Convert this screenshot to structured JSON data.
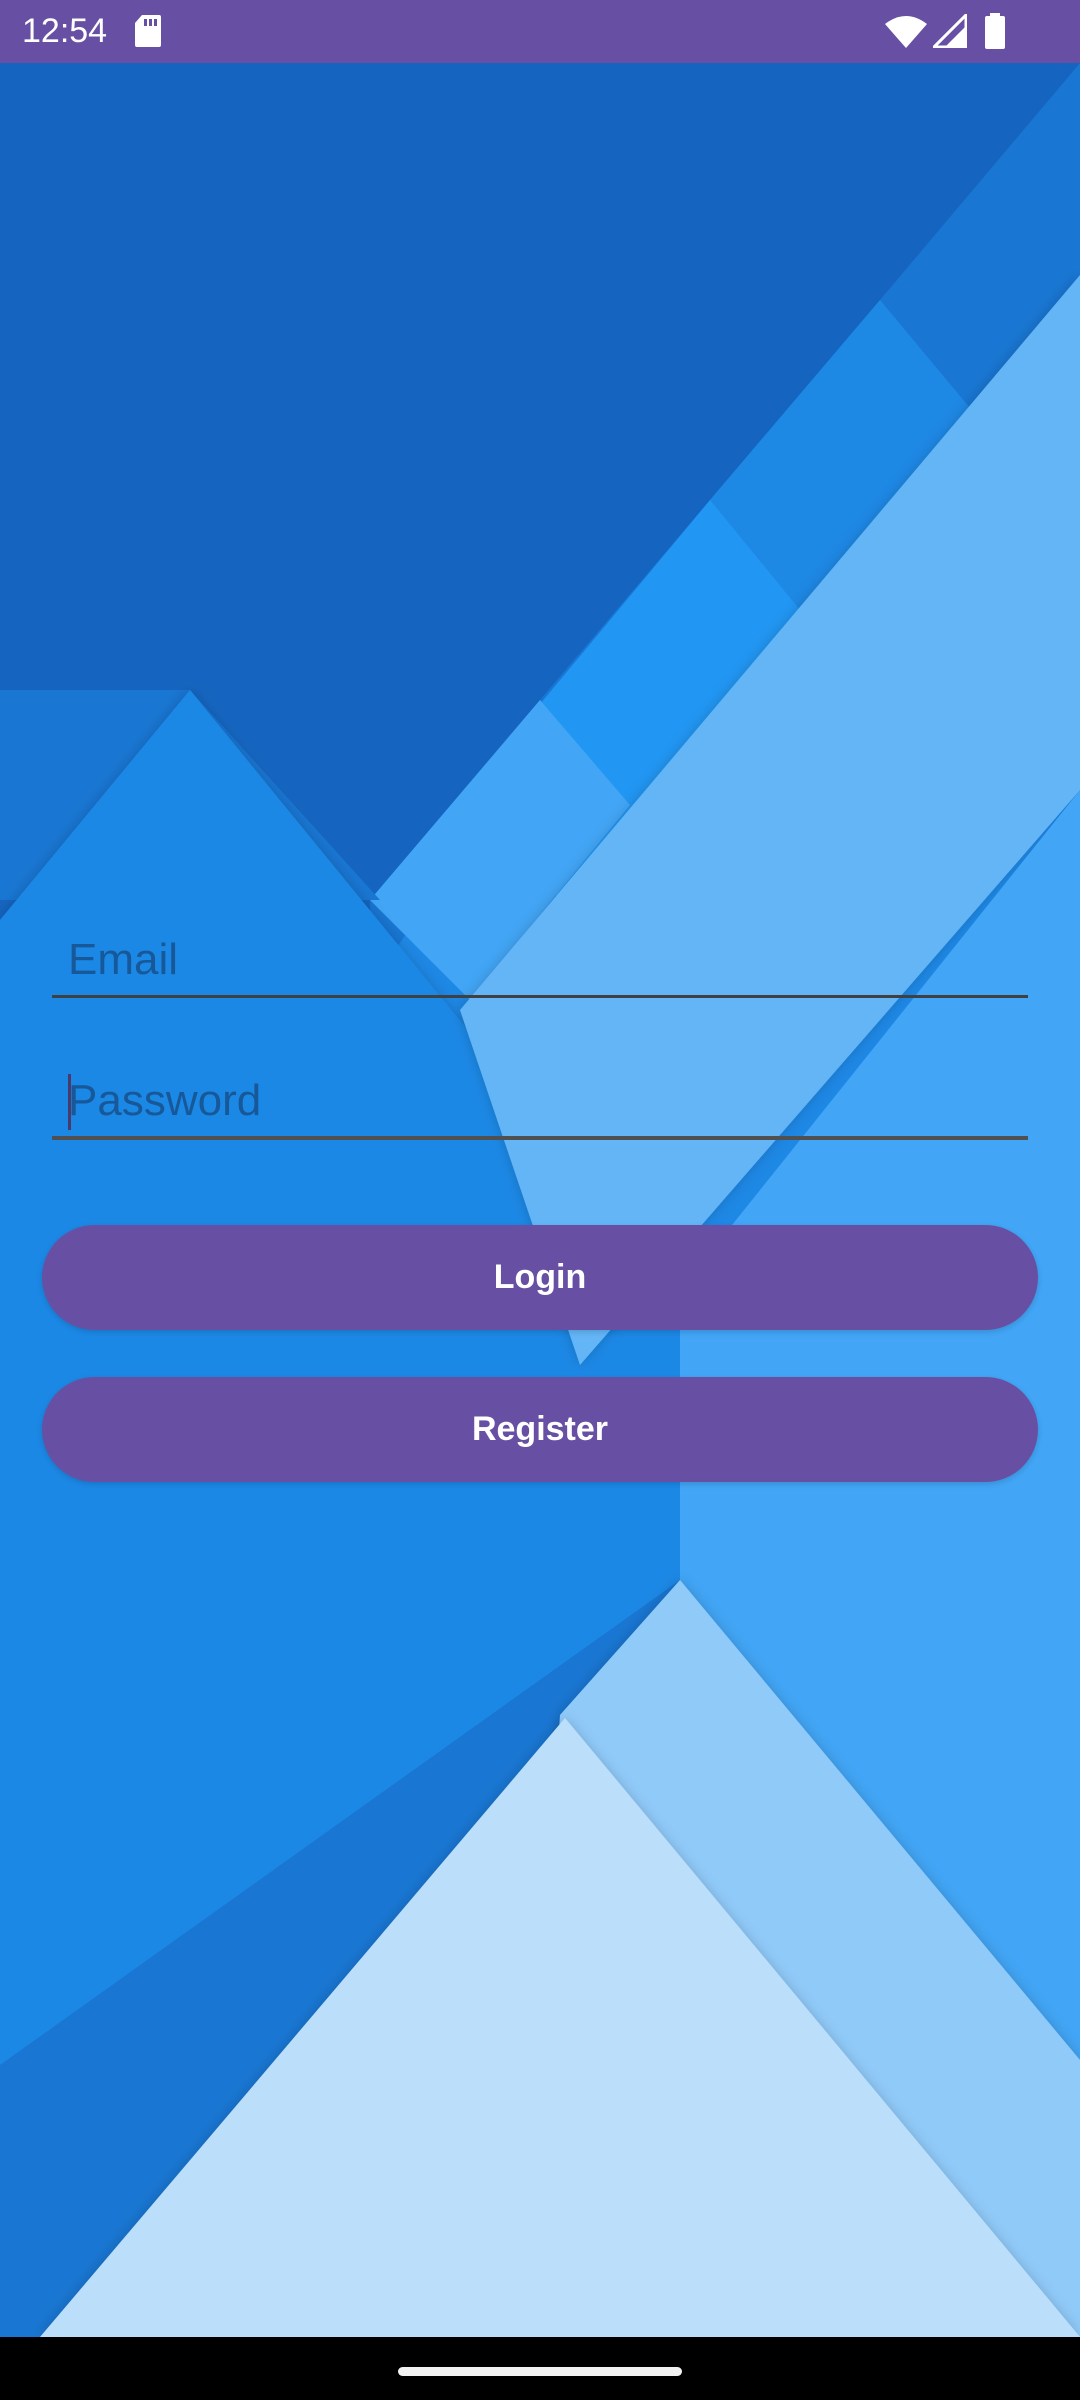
{
  "status_bar": {
    "time": "12:54",
    "background": "#6750a4",
    "icons": [
      "sd-card-icon",
      "wifi-icon",
      "cellular-signal-icon",
      "battery-icon"
    ]
  },
  "login_form": {
    "email": {
      "placeholder": "Email",
      "value": ""
    },
    "password": {
      "placeholder": "Password",
      "value": ""
    },
    "login_label": "Login",
    "register_label": "Register",
    "button_color": "#6750a4"
  },
  "background": {
    "colors": [
      "#1565c0",
      "#1976d2",
      "#1e88e5",
      "#2196f3",
      "#42a5f5",
      "#64b5f6",
      "#90caf9",
      "#bbdefb"
    ]
  }
}
